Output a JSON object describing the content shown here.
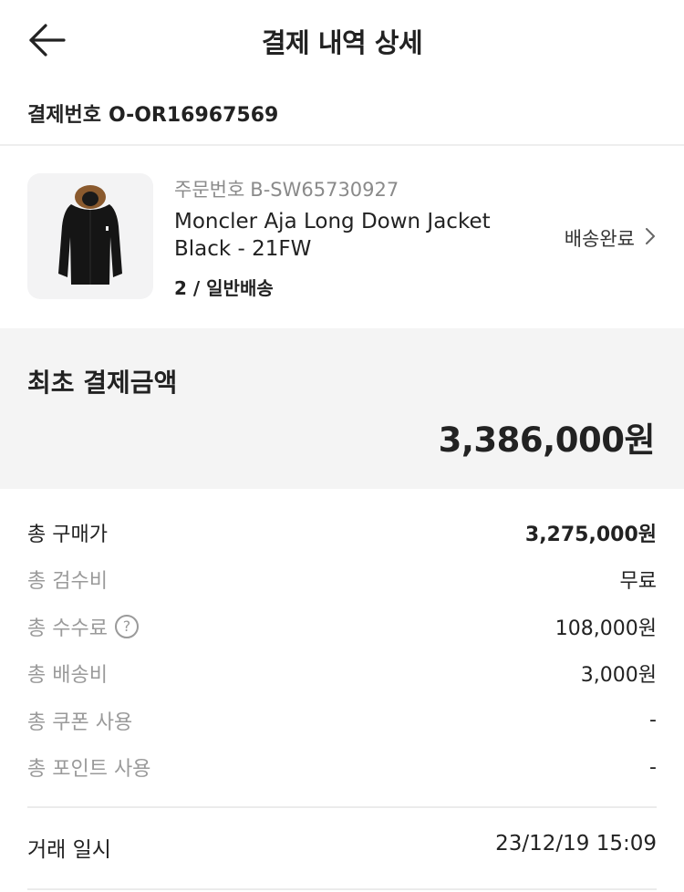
{
  "header": {
    "title": "결제 내역 상세",
    "back_icon": "arrow-left-icon"
  },
  "payment": {
    "number_label": "결제번호",
    "number_value": "O-OR16967569"
  },
  "product": {
    "order_label": "주문번호",
    "order_value": "B-SW65730927",
    "name": "Moncler Aja Long Down Jacket Black - 21FW",
    "size_option": "2 / 일반배송",
    "status": "배송완료",
    "status_icon": "chevron-right-icon",
    "image_icon": "jacket-icon"
  },
  "total": {
    "label": "최초 결제금액",
    "amount": "3,386,000원"
  },
  "breakdown": [
    {
      "label": "총 구매가",
      "value": "3,275,000원"
    },
    {
      "label": "총 검수비",
      "value": "무료"
    },
    {
      "label": "총 수수료",
      "value": "108,000원",
      "help": "?"
    },
    {
      "label": "총 배송비",
      "value": "3,000원"
    },
    {
      "label": "총 쿠폰 사용",
      "value": "-"
    },
    {
      "label": "총 포인트 사용",
      "value": "-"
    }
  ],
  "trade": {
    "label": "거래 일시",
    "value": "23/12/19 15:09"
  },
  "colors": {
    "text": "#222222",
    "muted": "#9a9a9a",
    "panel_bg": "#f4f4f4",
    "divider": "#eeeeee"
  }
}
